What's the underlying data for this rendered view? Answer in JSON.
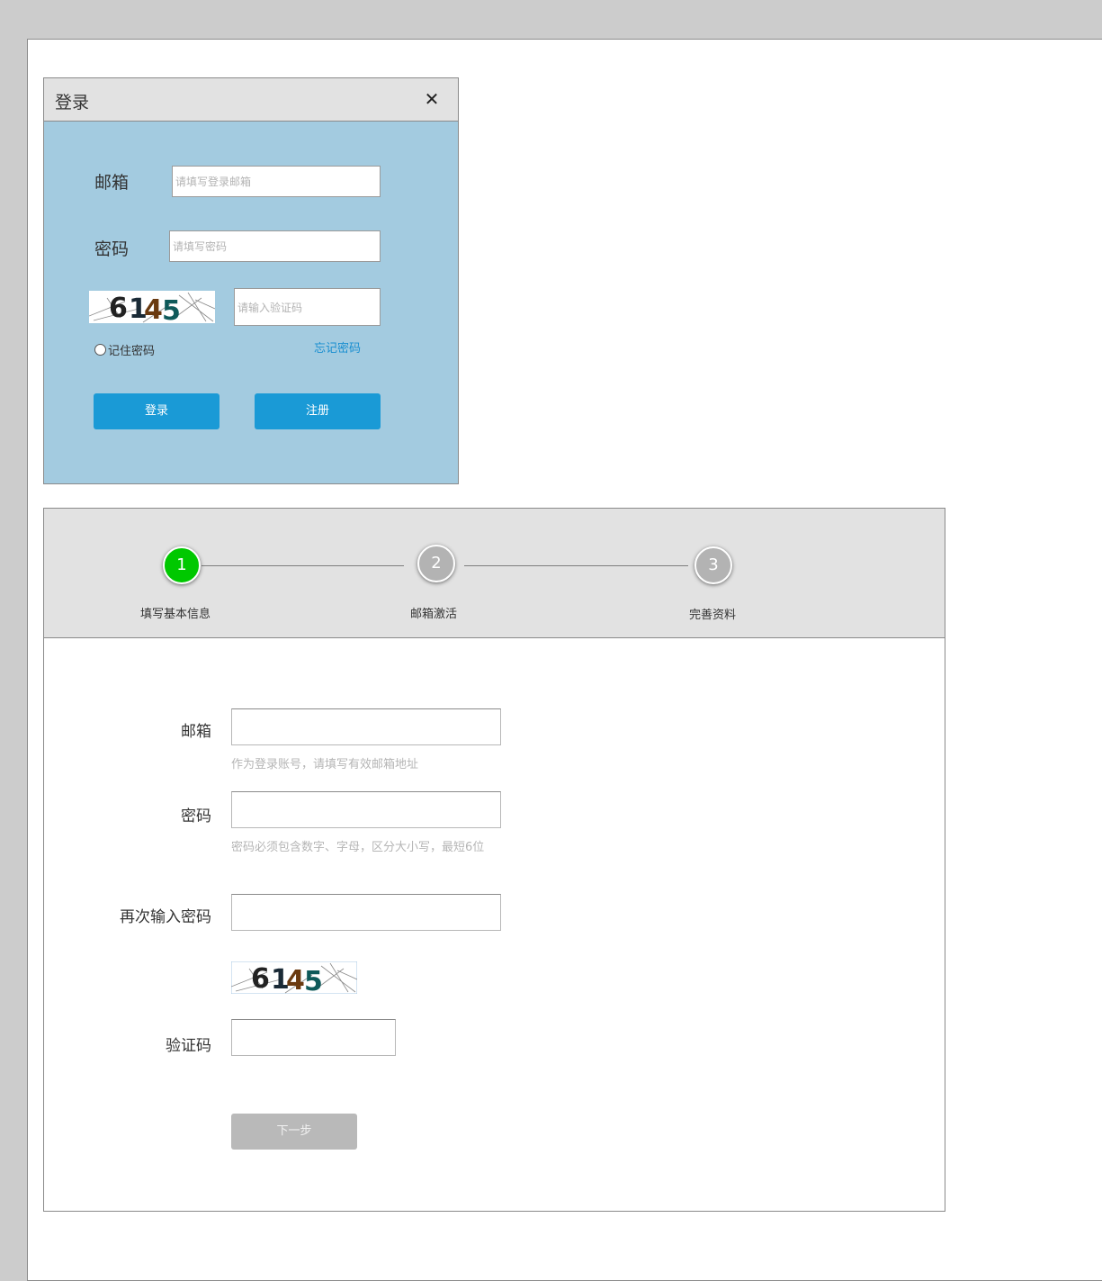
{
  "login": {
    "title": "登录",
    "close_icon": "close-icon",
    "email_label": "邮箱",
    "email_placeholder": "请填写登录邮箱",
    "password_label": "密码",
    "password_placeholder": "请填写密码",
    "captcha_text": "6145",
    "captcha_placeholder": "请输入验证码",
    "remember_label": "记住密码",
    "forgot_link": "忘记密码",
    "login_button": "登录",
    "register_button": "注册",
    "colors": {
      "panel_bg": "#a3cbe0",
      "button": "#1a9ad6",
      "link": "#1a8fd0"
    }
  },
  "register": {
    "steps": [
      {
        "number": "1",
        "label": "填写基本信息",
        "state": "active",
        "color": "#00c800"
      },
      {
        "number": "2",
        "label": "邮箱激活",
        "state": "inactive",
        "color": "#b3b3b3"
      },
      {
        "number": "3",
        "label": "完善资料",
        "state": "inactive",
        "color": "#b3b3b3"
      }
    ],
    "email_label": "邮箱",
    "email_value": "",
    "email_hint": "作为登录账号，请填写有效邮箱地址",
    "password_label": "密码",
    "password_value": "",
    "password_hint": "密码必须包含数字、字母，区分大小写，最短6位",
    "confirm_label": "再次输入密码",
    "confirm_value": "",
    "captcha_text": "6145",
    "captcha_label": "验证码",
    "captcha_value": "",
    "next_button": "下一步"
  }
}
